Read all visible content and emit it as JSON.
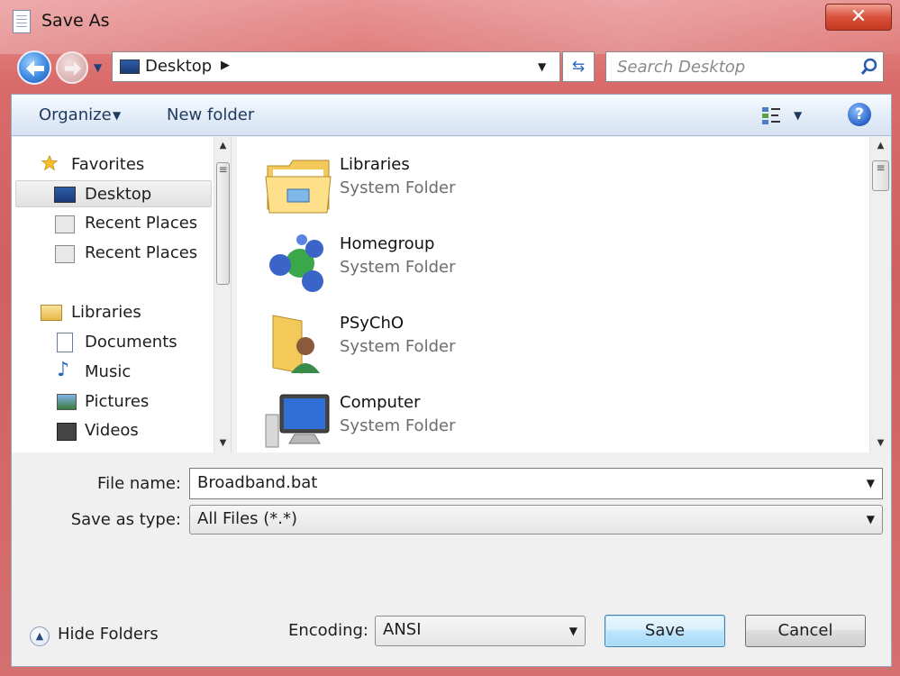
{
  "window": {
    "title": "Save As",
    "close_label": "✕"
  },
  "nav": {
    "address_crumb": "Desktop",
    "search_placeholder": "Search Desktop"
  },
  "toolbar": {
    "organize_label": "Organize",
    "new_folder_label": "New folder",
    "help_label": "?"
  },
  "navpane": {
    "items": [
      {
        "label": "Favorites",
        "icon": "star-icon"
      },
      {
        "label": "Desktop",
        "icon": "desktop-icon",
        "selected": true
      },
      {
        "label": "Recent Places",
        "icon": "recent-places-icon"
      },
      {
        "label": "Recent Places",
        "icon": "recent-places-icon"
      },
      {
        "label": "Libraries",
        "icon": "libraries-icon"
      },
      {
        "label": "Documents",
        "icon": "documents-icon"
      },
      {
        "label": "Music",
        "icon": "music-icon"
      },
      {
        "label": "Pictures",
        "icon": "pictures-icon"
      },
      {
        "label": "Videos",
        "icon": "videos-icon"
      }
    ]
  },
  "files": [
    {
      "name": "Libraries",
      "type": "System Folder",
      "icon": "libraries-folder-icon"
    },
    {
      "name": "Homegroup",
      "type": "System Folder",
      "icon": "homegroup-icon"
    },
    {
      "name": "PSyChO",
      "type": "System Folder",
      "icon": "user-folder-icon"
    },
    {
      "name": "Computer",
      "type": "System Folder",
      "icon": "computer-icon"
    }
  ],
  "form": {
    "file_name_label": "File name:",
    "file_name_value": "Broadband.bat",
    "save_type_label": "Save as type:",
    "save_type_value": "All Files  (*.*)",
    "encoding_label": "Encoding:",
    "encoding_value": "ANSI"
  },
  "buttons": {
    "hide_folders": "Hide Folders",
    "save": "Save",
    "cancel": "Cancel"
  },
  "colors": {
    "frame": "#d96b6b",
    "accent": "#3c7fb1",
    "toolbar": "#e4edf8"
  }
}
